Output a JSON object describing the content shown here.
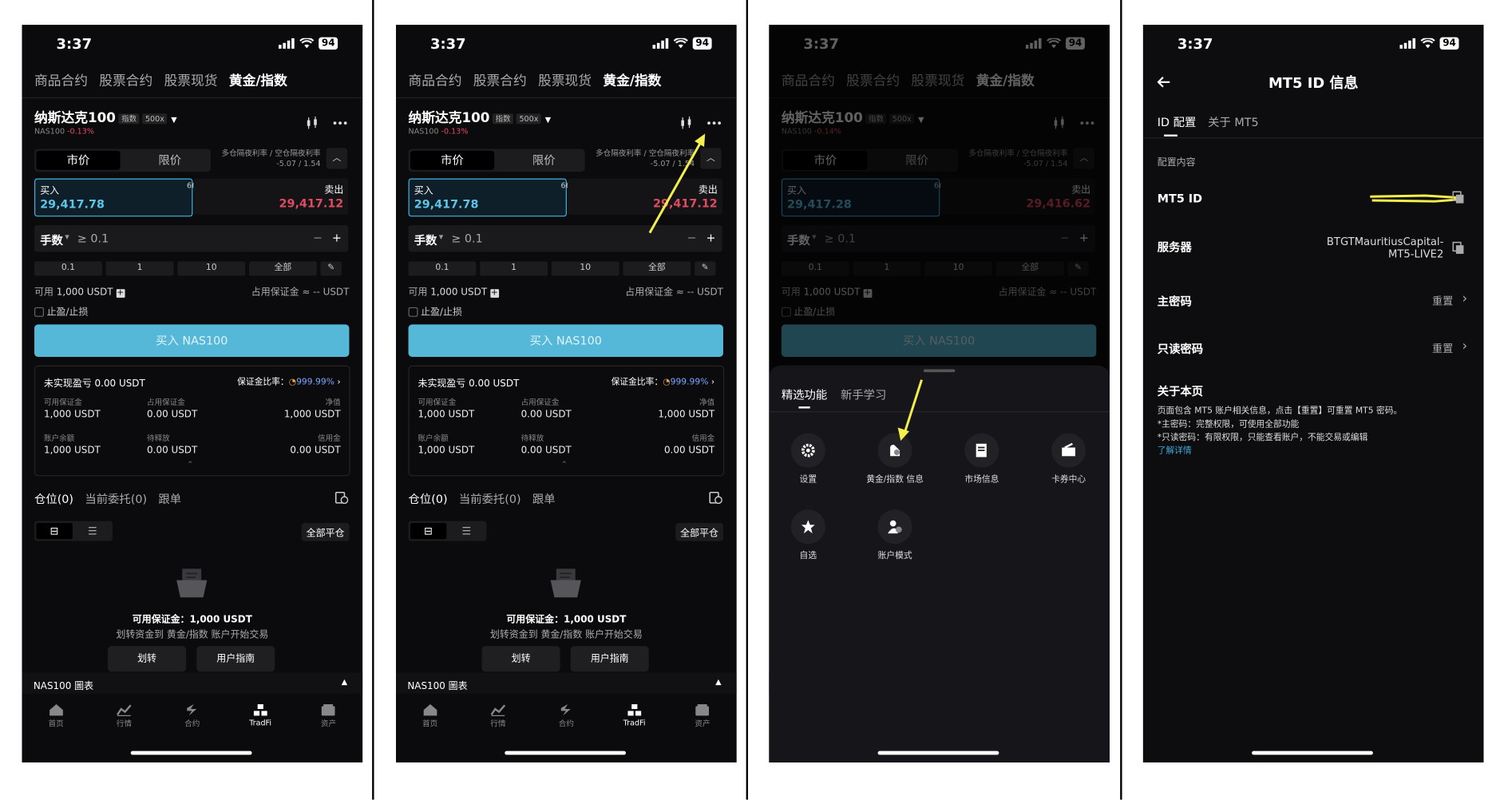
{
  "status": {
    "time": "3:37",
    "battery": "94"
  },
  "market_tabs": [
    "商品合约",
    "股票合约",
    "股票现货",
    "黄金/指数"
  ],
  "symbol": {
    "name": "纳斯达克100",
    "tag": "指数",
    "leverage": "500x",
    "code": "NAS100",
    "change": "-0.13%",
    "change_dim": "-0.14%"
  },
  "order_type": {
    "market": "市价",
    "limit": "限价"
  },
  "funding": {
    "label": "多仓隔夜利率 / 空仓隔夜利率",
    "value": "-5.07 / 1.54"
  },
  "quote": {
    "buy_label": "买入",
    "sell_label": "卖出",
    "spread": "66",
    "buy_price": "29,417.78",
    "sell_price": "29,417.12",
    "buy_price_dim": "29,417.28",
    "sell_price_dim": "29,416.62"
  },
  "lot": {
    "label": "手数",
    "placeholder": "≥ 0.1",
    "minus": "−",
    "plus": "+"
  },
  "quick_lots": [
    "0.1",
    "1",
    "10",
    "全部"
  ],
  "available": {
    "label": "可用",
    "value": "1,000 USDT"
  },
  "margin_used": {
    "label": "占用保证金",
    "value": "≈ -- USDT"
  },
  "tpsl": "止盈/止损",
  "buy_button": "买入 NAS100",
  "account": {
    "unrealized_label": "未实现盈亏",
    "unrealized_value": "0.00 USDT",
    "margin_ratio_label": "保证金比率：",
    "margin_ratio_value": "999.99%",
    "cells": [
      {
        "label": "可用保证金",
        "value": "1,000 USDT"
      },
      {
        "label": "占用保证金",
        "value": "0.00 USDT"
      },
      {
        "label": "净值",
        "value": "1,000 USDT"
      },
      {
        "label": "账户余额",
        "value": "1,000 USDT"
      },
      {
        "label": "待释放",
        "value": "0.00 USDT"
      },
      {
        "label": "信用金",
        "value": "0.00 USDT"
      }
    ]
  },
  "positions_tabs": [
    "仓位(0)",
    "当前委托(0)",
    "跟单"
  ],
  "close_all": "全部平仓",
  "empty": {
    "margin": "可用保证金：1,000 USDT",
    "hint": "划转资金到 黄金/指数 账户开始交易"
  },
  "guide_buttons": {
    "transfer": "划转",
    "guide": "用户指南"
  },
  "chart_bar": "NAS100 圖表",
  "nav": [
    "首页",
    "行情",
    "合约",
    "TradFi",
    "资产"
  ],
  "sheet": {
    "tabs": [
      "精选功能",
      "新手学习"
    ],
    "features": [
      "设置",
      "黄金/指数 信息",
      "市场信息",
      "卡券中心",
      "自选",
      "账户模式"
    ]
  },
  "mt5": {
    "title": "MT5 ID 信息",
    "tabs": [
      "ID 配置",
      "关于 MT5"
    ],
    "section": "配置内容",
    "id_label": "MT5 ID",
    "server_label": "服务器",
    "server_value": "BTGTMauritiusCapital-MT5-LIVE2",
    "main_pw_label": "主密码",
    "ro_pw_label": "只读密码",
    "reset": "重置",
    "about_title": "关于本页",
    "about_lines": [
      "页面包含 MT5 账户相关信息，点击【重置】可重置 MT5 密码。",
      "*主密码：完整权限，可使用全部功能",
      "*只读密码：有限权限，只能查看账户，不能交易或编辑"
    ],
    "learn_more": "了解详情"
  },
  "colors": {
    "accent": "#56b8d8",
    "buy_text": "#5ec5e8",
    "sell": "#e14b62",
    "link": "#3fa9d8",
    "annotation": "#f3ee4c"
  }
}
